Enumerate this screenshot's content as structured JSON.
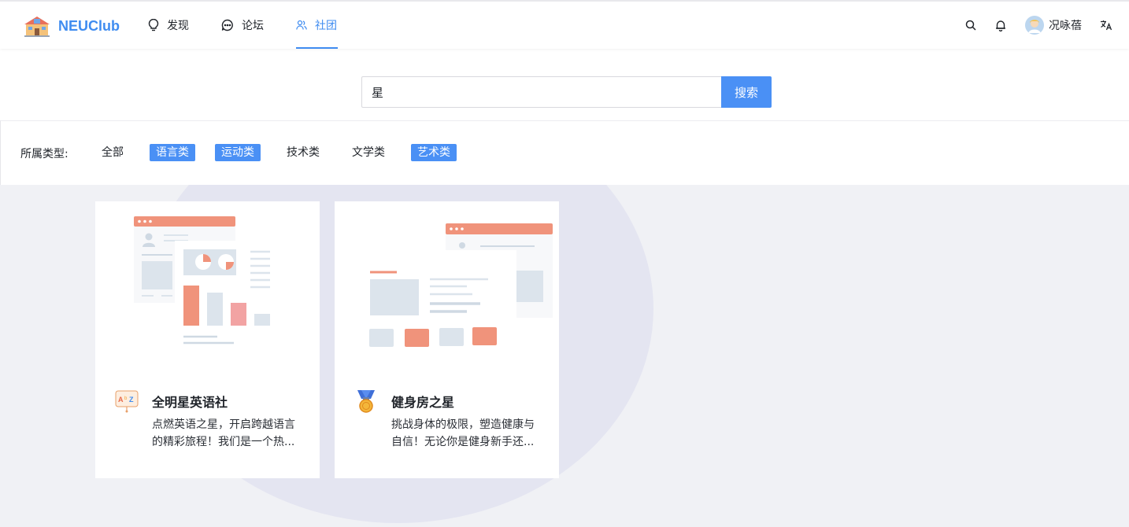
{
  "brand": {
    "name": "NEUClub"
  },
  "nav": {
    "items": [
      {
        "label": "发现",
        "icon": "lightbulb-icon"
      },
      {
        "label": "论坛",
        "icon": "chat-bubble-icon"
      },
      {
        "label": "社团",
        "icon": "users-icon",
        "active": true
      }
    ]
  },
  "header": {
    "user_name": "况咏蓓",
    "search_icon": "search-icon",
    "bell_icon": "bell-icon",
    "lang_icon": "translate-icon"
  },
  "search": {
    "value": "星",
    "button_label": "搜索"
  },
  "filters": {
    "label": "所属类型:",
    "options": [
      {
        "label": "全部",
        "selected": false
      },
      {
        "label": "语言类",
        "selected": true
      },
      {
        "label": "运动类",
        "selected": true
      },
      {
        "label": "技术类",
        "selected": false
      },
      {
        "label": "文学类",
        "selected": false
      },
      {
        "label": "艺术类",
        "selected": true
      }
    ]
  },
  "clubs": [
    {
      "name": "全明星英语社",
      "description": "点燃英语之星，开启跨越语言的精彩旅程！我们是一个热...",
      "icon": "abc-board-icon"
    },
    {
      "name": "健身房之星",
      "description": "挑战身体的极限，塑造健康与自信！无论你是健身新手还...",
      "icon": "medal-icon"
    }
  ],
  "colors": {
    "accent": "#4a90f5",
    "illustration_salmon": "#f0937b",
    "illustration_blue": "#dce4ec",
    "background": "#f0f1f5"
  }
}
